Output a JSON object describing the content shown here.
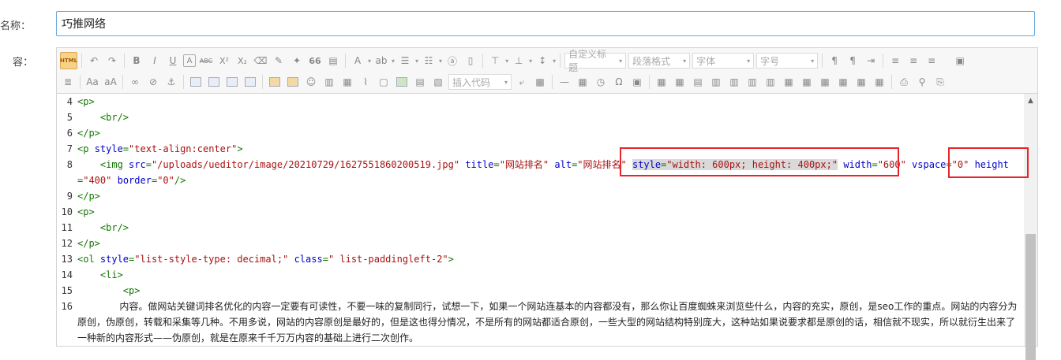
{
  "form": {
    "name_label": "名称：",
    "content_label": "容：",
    "title_value": "巧推网络"
  },
  "toolbar": {
    "html_label": "HTML",
    "dropdowns": {
      "custom_title": "自定义标题",
      "paragraph_format": "段落格式",
      "font_family": "字体",
      "font_size": "字号",
      "insert_code": "插入代码"
    },
    "glyphs": {
      "bold": "B",
      "italic": "I",
      "underline": "U",
      "font_border": "A",
      "strike": "ABC",
      "superscript": "X²",
      "subscript": "X₂",
      "blockquote": "66",
      "font_color": "A",
      "omega": "Ω"
    }
  },
  "code": {
    "lines": [
      {
        "n": "4",
        "segments": [
          {
            "c": "tag",
            "t": "<p>"
          }
        ]
      },
      {
        "n": "5",
        "segments": [
          {
            "c": "tag",
            "t": "    <br/>"
          }
        ]
      },
      {
        "n": "6",
        "segments": [
          {
            "c": "tag",
            "t": "</p>"
          }
        ]
      },
      {
        "n": "7",
        "segments": [
          {
            "c": "tag",
            "t": "<p "
          },
          {
            "c": "attr",
            "t": "style"
          },
          {
            "c": "tag",
            "t": "="
          },
          {
            "c": "str",
            "t": "\"text-align:center\""
          },
          {
            "c": "tag",
            "t": ">"
          }
        ]
      },
      {
        "n": "8",
        "segments": [
          {
            "c": "tag",
            "t": "    <img "
          },
          {
            "c": "attr",
            "t": "src"
          },
          {
            "c": "tag",
            "t": "="
          },
          {
            "c": "str",
            "t": "\"/uploads/ueditor/image/20210729/1627551860200519.jpg\""
          },
          {
            "c": "tag",
            "t": " "
          },
          {
            "c": "attr",
            "t": "title"
          },
          {
            "c": "tag",
            "t": "="
          },
          {
            "c": "str",
            "t": "\"网站排名\""
          },
          {
            "c": "tag",
            "t": " "
          },
          {
            "c": "attr",
            "t": "alt"
          },
          {
            "c": "tag",
            "t": "="
          },
          {
            "c": "str",
            "t": "\"网站排名\""
          },
          {
            "c": "tag",
            "t": " "
          },
          {
            "c": "attr sel",
            "t": "style"
          },
          {
            "c": "tag sel",
            "t": "="
          },
          {
            "c": "str sel",
            "t": "\"width: 600px; height: 400px;\""
          },
          {
            "c": "tag",
            "t": " "
          },
          {
            "c": "attr",
            "t": "width"
          },
          {
            "c": "tag",
            "t": "="
          },
          {
            "c": "str",
            "t": "\"600\""
          },
          {
            "c": "tag",
            "t": " "
          },
          {
            "c": "attr",
            "t": "vspace"
          },
          {
            "c": "tag",
            "t": "="
          },
          {
            "c": "str",
            "t": "\"0\""
          },
          {
            "c": "tag",
            "t": " "
          },
          {
            "c": "attr",
            "t": "height"
          },
          {
            "c": "tag",
            "t": "="
          },
          {
            "c": "str",
            "t": "\"400\""
          },
          {
            "c": "tag",
            "t": " "
          },
          {
            "c": "attr",
            "t": "border"
          },
          {
            "c": "tag",
            "t": "="
          },
          {
            "c": "str",
            "t": "\"0\""
          },
          {
            "c": "tag",
            "t": "/>"
          }
        ]
      },
      {
        "n": "9",
        "segments": [
          {
            "c": "tag",
            "t": "</p>"
          }
        ]
      },
      {
        "n": "10",
        "segments": [
          {
            "c": "tag",
            "t": "<p>"
          }
        ]
      },
      {
        "n": "11",
        "segments": [
          {
            "c": "tag",
            "t": "    <br/>"
          }
        ]
      },
      {
        "n": "12",
        "segments": [
          {
            "c": "tag",
            "t": "</p>"
          }
        ]
      },
      {
        "n": "13",
        "segments": [
          {
            "c": "tag",
            "t": "<ol "
          },
          {
            "c": "attr",
            "t": "style"
          },
          {
            "c": "tag",
            "t": "="
          },
          {
            "c": "str",
            "t": "\"list-style-type: decimal;\""
          },
          {
            "c": "tag",
            "t": " "
          },
          {
            "c": "attr",
            "t": "class"
          },
          {
            "c": "tag",
            "t": "="
          },
          {
            "c": "str",
            "t": "\" list-paddingleft-2\""
          },
          {
            "c": "tag",
            "t": ">"
          }
        ]
      },
      {
        "n": "14",
        "segments": [
          {
            "c": "tag",
            "t": "    <li>"
          }
        ]
      },
      {
        "n": "15",
        "segments": [
          {
            "c": "tag",
            "t": "        <p>"
          }
        ]
      },
      {
        "n": "16",
        "segments": [
          {
            "c": "txt prose",
            "t": "              内容。做网站关键词排名优化的内容一定要有可读性，不要一味的复制同行，试想一下，如果一个网站连基本的内容都没有，那么你让百度蜘蛛来浏览些什么，内容的充实，原创，是seo工作的重点。网站的内容分为原创，伪原创，转载和采集等几种。不用多说，网站的内容原创是最好的，但是这也得分情况，不是所有的网站都适合原创，一些大型的网站结构特别庞大，这种站如果说要求都是原创的话，相信就不现实，所以就衍生出来了一种新的内容形式——伪原创，就是在原来千千万万内容的基础上进行二次创作。"
          }
        ]
      }
    ]
  }
}
